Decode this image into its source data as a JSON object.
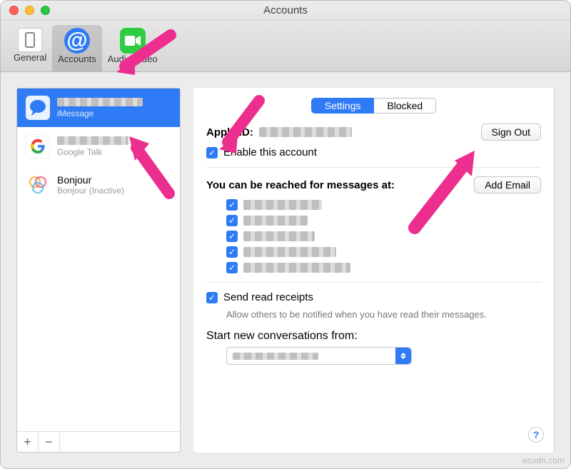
{
  "window": {
    "title": "Accounts"
  },
  "toolbar": {
    "items": [
      {
        "label": "General"
      },
      {
        "label": "Accounts"
      },
      {
        "label": "Audio/Video"
      }
    ]
  },
  "sidebar": {
    "accounts": [
      {
        "title": "████████████",
        "subtitle": "iMessage",
        "selected": true
      },
      {
        "title": "██████████",
        "subtitle": "Google Talk",
        "selected": false
      },
      {
        "title": "Bonjour",
        "subtitle": "Bonjour (Inactive)",
        "selected": false
      }
    ],
    "buttons": {
      "add": "+",
      "remove": "−"
    }
  },
  "segments": {
    "settings": "Settings",
    "blocked": "Blocked"
  },
  "apple_id": {
    "label": "Apple ID:",
    "value": "████████"
  },
  "sign_out": "Sign Out",
  "enable_label": "Enable this account",
  "reach_label": "You can be reached for messages at:",
  "add_email": "Add Email",
  "reach_items": [
    "",
    "",
    "",
    "",
    ""
  ],
  "read_receipts": {
    "label": "Send read receipts",
    "hint": "Allow others to be notified when you have read their messages."
  },
  "start_label": "Start new conversations from:",
  "help": "?",
  "watermark": "wsxdn.com"
}
